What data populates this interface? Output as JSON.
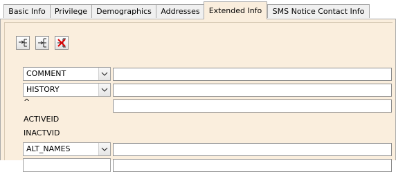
{
  "tabs": [
    {
      "label": "Basic Info"
    },
    {
      "label": "Privilege"
    },
    {
      "label": "Demographics"
    },
    {
      "label": "Addresses"
    },
    {
      "label": "Extended Info"
    },
    {
      "label": "SMS Notice Contact Info"
    }
  ],
  "active_tab": "Extended Info",
  "toolbar": [
    {
      "icon": "expand-tree-icon"
    },
    {
      "icon": "add-branch-icon"
    },
    {
      "icon": "delete-branch-icon"
    }
  ],
  "rows": [
    {
      "type": "combo",
      "value": "COMMENT",
      "field_value": ""
    },
    {
      "type": "combo",
      "value": "HISTORY",
      "field_value": ""
    },
    {
      "type": "label",
      "text": "^",
      "field_value": ""
    },
    {
      "type": "label",
      "text": "ACTIVEID"
    },
    {
      "type": "label",
      "text": "INACTVID"
    },
    {
      "type": "combo",
      "value": "ALT_NAMES",
      "field_value": ""
    }
  ],
  "colors": {
    "panel": "#faeedd",
    "tab_inactive": "#f0f0f0",
    "delete_x": "#e00000"
  }
}
